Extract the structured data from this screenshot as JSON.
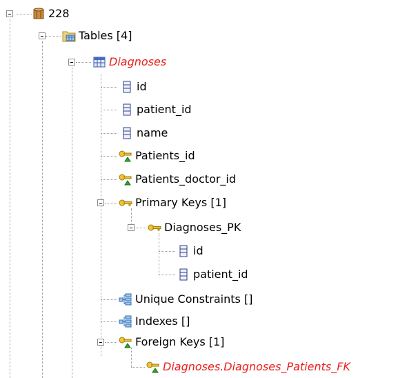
{
  "tree": {
    "root": {
      "label": "228",
      "icon": "database-icon"
    },
    "tables": {
      "label": "Tables [4]",
      "icon": "folder-table-icon"
    },
    "table": {
      "label": "Diagnoses",
      "icon": "table-grid-icon",
      "color": "#e8201c"
    },
    "columns": [
      {
        "label": "id",
        "icon": "column-icon"
      },
      {
        "label": "patient_id",
        "icon": "column-icon"
      },
      {
        "label": "name",
        "icon": "column-icon"
      }
    ],
    "foreign_key_columns": [
      {
        "label": "Patients_id",
        "icon": "foreign-key-icon"
      },
      {
        "label": "Patients_doctor_id",
        "icon": "foreign-key-icon"
      }
    ],
    "primary_keys": {
      "label": "Primary Keys [1]",
      "icon": "key-icon",
      "key": {
        "label": "Diagnoses_PK",
        "icon": "key-icon",
        "columns": [
          {
            "label": "id",
            "icon": "column-icon"
          },
          {
            "label": "patient_id",
            "icon": "column-icon"
          }
        ]
      }
    },
    "unique_constraints": {
      "label": "Unique Constraints []",
      "icon": "index-icon"
    },
    "indexes": {
      "label": "Indexes []",
      "icon": "index-icon"
    },
    "foreign_keys": {
      "label": "Foreign Keys [1]",
      "icon": "foreign-key-icon",
      "items": [
        {
          "label": "Diagnoses.Diagnoses_Patients_FK",
          "icon": "foreign-key-icon",
          "color": "#e8201c"
        }
      ]
    }
  }
}
